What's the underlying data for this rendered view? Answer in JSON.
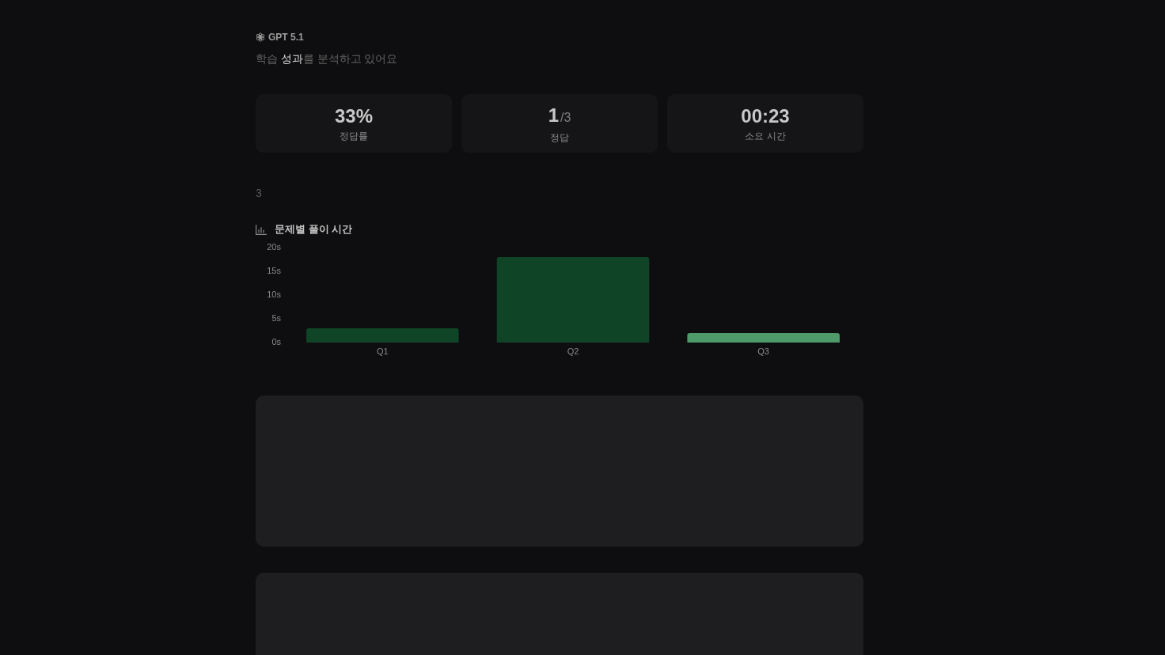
{
  "header": {
    "model": "GPT 5.1",
    "status": "학습 **성과**를 분석하고 있어요"
  },
  "stats": [
    {
      "value": "33%",
      "label": "정답률"
    },
    {
      "value": "1",
      "suffix": "/3",
      "label": "정답"
    },
    {
      "value": "00:23",
      "label": "소요 시간"
    }
  ],
  "question_count": "3",
  "time_chart": {
    "title": "문제별 풀이 시간",
    "chart_data": {
      "type": "bar",
      "categories": [
        "Q1",
        "Q2",
        "Q3"
      ],
      "values": [
        3,
        18,
        2
      ],
      "colors": [
        "#0f4526",
        "#0f4526",
        "#4f9a6a"
      ],
      "ylim": [
        0,
        20
      ],
      "yticks": [
        {
          "value": 0,
          "label": "0s"
        },
        {
          "value": 5,
          "label": "5s"
        },
        {
          "value": 10,
          "label": "10s"
        },
        {
          "value": 15,
          "label": "15s"
        },
        {
          "value": 20,
          "label": "20s"
        }
      ]
    }
  },
  "loading_panels": [
    {
      "loading": true
    },
    {
      "loading": true
    }
  ]
}
